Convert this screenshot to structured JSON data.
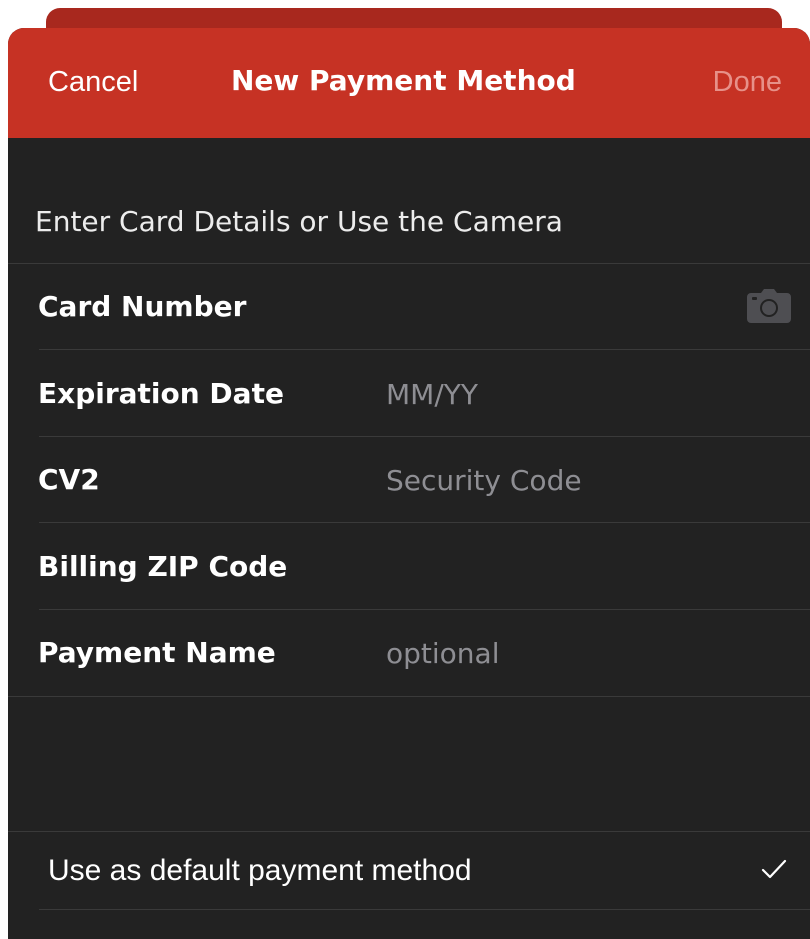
{
  "navbar": {
    "cancel_label": "Cancel",
    "title": "New Payment Method",
    "done_label": "Done"
  },
  "section": {
    "header": "Enter Card Details or Use the Camera"
  },
  "fields": [
    {
      "label": "Card Number",
      "placeholder": ""
    },
    {
      "label": "Expiration Date",
      "placeholder": "MM/YY"
    },
    {
      "label": "CV2",
      "placeholder": "Security Code"
    },
    {
      "label": "Billing ZIP Code",
      "placeholder": ""
    },
    {
      "label": "Payment Name",
      "placeholder": "optional"
    }
  ],
  "default_option": {
    "label": "Use as default payment method",
    "checked": true
  },
  "icons": {
    "camera": "camera-icon",
    "check": "checkmark-icon"
  },
  "colors": {
    "navbar": "#c63224",
    "background": "#222222",
    "done_disabled": "#e79189",
    "placeholder": "#8e8e93"
  }
}
